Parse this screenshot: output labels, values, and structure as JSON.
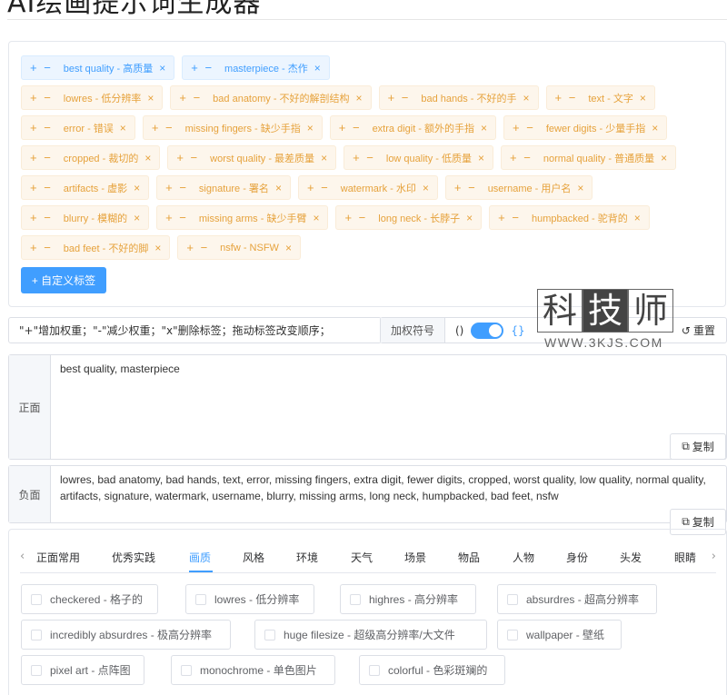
{
  "page": {
    "title": "AI绘画提示词生成器"
  },
  "selected_tags": {
    "rows": [
      [
        {
          "label": "best quality - 高质量",
          "kind": "positive"
        },
        {
          "label": "masterpiece - 杰作",
          "kind": "positive"
        }
      ],
      [
        {
          "label": "lowres - 低分辨率",
          "kind": "negative"
        },
        {
          "label": "bad anatomy - 不好的解剖结构",
          "kind": "negative"
        },
        {
          "label": "bad hands - 不好的手",
          "kind": "negative"
        },
        {
          "label": "text - 文字",
          "kind": "negative"
        }
      ],
      [
        {
          "label": "error - 错误",
          "kind": "negative"
        },
        {
          "label": "missing fingers - 缺少手指",
          "kind": "negative"
        },
        {
          "label": "extra digit - 额外的手指",
          "kind": "negative"
        },
        {
          "label": "fewer digits - 少量手指",
          "kind": "negative"
        }
      ],
      [
        {
          "label": "cropped - 裁切的",
          "kind": "negative"
        },
        {
          "label": "worst quality - 最差质量",
          "kind": "negative"
        },
        {
          "label": "low quality - 低质量",
          "kind": "negative"
        },
        {
          "label": "normal quality - 普通质量",
          "kind": "negative"
        }
      ],
      [
        {
          "label": "artifacts - 虚影",
          "kind": "negative"
        },
        {
          "label": "signature - 署名",
          "kind": "negative"
        },
        {
          "label": "watermark - 水印",
          "kind": "negative"
        },
        {
          "label": "username - 用户名",
          "kind": "negative"
        }
      ],
      [
        {
          "label": "blurry - 模糊的",
          "kind": "negative"
        },
        {
          "label": "missing arms - 缺少手臂",
          "kind": "negative"
        },
        {
          "label": "long neck - 长脖子",
          "kind": "negative"
        },
        {
          "label": "humpbacked - 驼背的",
          "kind": "negative"
        }
      ],
      [
        {
          "label": "bad feet - 不好的脚",
          "kind": "negative"
        },
        {
          "label": "nsfw - NSFW",
          "kind": "negative"
        }
      ]
    ],
    "plus_minus": "+ −",
    "remove_glyph": "×",
    "custom_button": "+ 自定义标签"
  },
  "controls": {
    "hint": "\"+\"增加权重；\"-\"减少权重；\"x\"删除标签；拖动标签改变顺序；",
    "weight_label": "加权符号",
    "paren_round": "()",
    "paren_curly": "{}",
    "switch_on": true,
    "reset_label": "重置"
  },
  "watermark": {
    "chars": [
      "科",
      "技",
      "师"
    ],
    "url": "WWW.3KJS.COM"
  },
  "prompts": {
    "positive": {
      "label": "正面",
      "text": "best quality, masterpiece",
      "copy_label": "复制"
    },
    "negative": {
      "label": "负面",
      "text": "lowres, bad anatomy, bad hands, text, error, missing fingers, extra digit, fewer digits, cropped, worst quality, low quality, normal quality, artifacts, signature, watermark, username, blurry, missing arms, long neck, humpbacked, bad feet, nsfw",
      "copy_label": "复制"
    }
  },
  "categories": {
    "tabs": [
      "正面常用",
      "优秀实践",
      "画质",
      "风格",
      "环境",
      "天气",
      "场景",
      "物品",
      "人物",
      "身份",
      "头发",
      "眼睛"
    ],
    "active_tab": "画质",
    "options": [
      {
        "label": "checkered - 格子的",
        "checked": false
      },
      {
        "label": "lowres - 低分辨率",
        "checked": false
      },
      {
        "label": "highres - 高分辨率",
        "checked": false
      },
      {
        "label": "absurdres - 超高分辨率",
        "checked": false
      },
      {
        "label": "incredibly absurdres - 极高分辨率",
        "checked": false
      },
      {
        "label": "huge filesize - 超级高分辨率/大文件",
        "checked": false
      },
      {
        "label": "wallpaper - 壁纸",
        "checked": false
      },
      {
        "label": "pixel art - 点阵图",
        "checked": false
      },
      {
        "label": "monochrome - 单色图片",
        "checked": false
      },
      {
        "label": "colorful - 色彩斑斓的",
        "checked": false
      }
    ]
  },
  "colors": {
    "accent": "#409eff",
    "positive_tag_bg": "#ecf5ff",
    "negative_tag_bg": "#fdf6ec",
    "negative_tag_text": "#e6a23c"
  }
}
